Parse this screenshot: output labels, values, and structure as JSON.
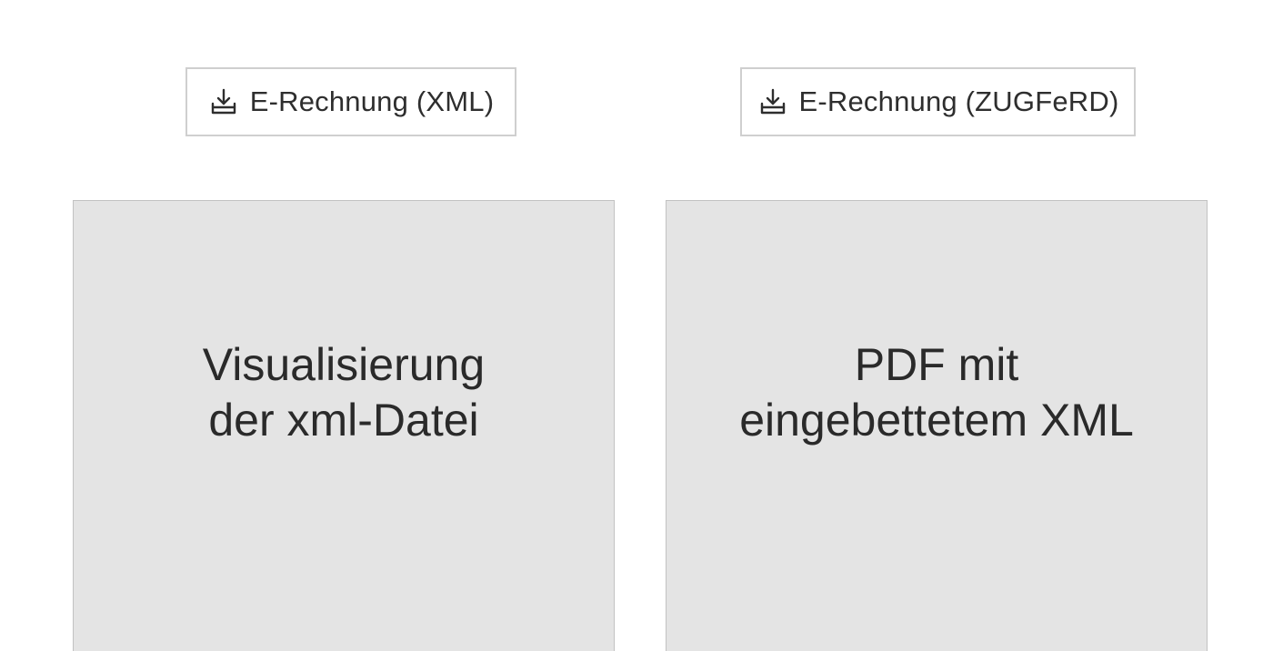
{
  "buttons": {
    "xml": {
      "label": "E-Rechnung (XML)",
      "icon": "download-tray-icon"
    },
    "zugferd": {
      "label": "E-Rechnung (ZUGFeRD)",
      "icon": "download-tray-icon"
    }
  },
  "previews": {
    "xml": {
      "line1": "Visualisierung",
      "line2": "der xml-Datei"
    },
    "zugferd": {
      "line1": "PDF mit",
      "line2": "eingebettetem XML"
    }
  },
  "colors": {
    "button_border": "#cfcfcf",
    "preview_background": "#e4e4e4",
    "preview_border": "#c2c2c2",
    "text": "#2b2b2b"
  }
}
